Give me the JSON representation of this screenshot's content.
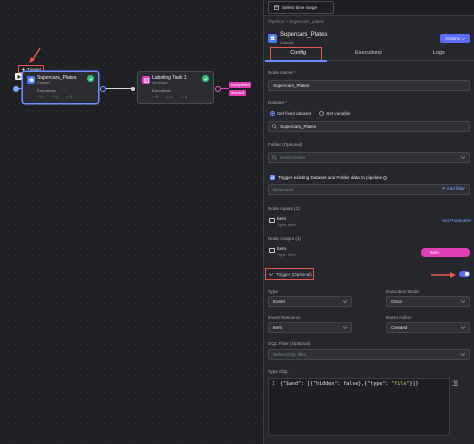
{
  "canvas": {
    "trigger_tag": "Trigger",
    "nodes": [
      {
        "title": "Supercars_Plates",
        "subtitle": "Dataset",
        "executions_label": "Executions",
        "stats": [
          "0",
          "0",
          "0"
        ]
      },
      {
        "title": "Labeling Task 1",
        "subtitle": "Workflow",
        "executions_label": "Executions",
        "stats": [
          "0",
          "0",
          "0"
        ]
      }
    ],
    "edge_labels": [
      "completed",
      "discard"
    ]
  },
  "panel": {
    "time_range_label": "Select time range",
    "breadcrumb": "Pipeline  >  Supercars_plates",
    "header": {
      "title": "Supercars_Plates",
      "subtitle": "Dataset",
      "actions_label": "Actions"
    },
    "tabs": [
      "Config",
      "Executions",
      "Logs"
    ],
    "node_name_label": "Node Name *",
    "node_name_value": "Supercars_Plates",
    "dataset_label": "Dataset *",
    "radio_fixed": "Set fixed dataset",
    "radio_variable": "Set variable",
    "dataset_value": "Supercars_Plates",
    "folder_label": "Folder (Optional)",
    "folder_placeholder": "Select folder",
    "checkbox_label": "Trigger existing Dataset and Folder data to pipeline",
    "filter_placeholder": "Items count",
    "add_filter": "Add filter",
    "node_inputs_label": "Node Inputs (1)",
    "input_item": "Item",
    "input_type": "Type: Item",
    "set_parameter": "Set Parameter",
    "node_output_label": "Node Output (1)",
    "output_item": "Item",
    "output_type": "Type: Item",
    "output_pill": "Item",
    "trigger_optional": "Trigger (Optional)",
    "type_label": "Type",
    "type_value": "Event",
    "exec_mode_label": "Execution Mode",
    "exec_mode_value": "Once",
    "event_resource_label": "Event Resource",
    "event_resource_value": "Item",
    "event_action_label": "Event Action",
    "event_action_value": "Created",
    "dql_filter_label": "DQL Filter (Optional)",
    "dql_filter_placeholder": "Select DQL filter",
    "type_dql_label": "Type DQL",
    "code_line_number": "1",
    "code_pre": "{\"$and\": [{\"hidden\": false},{\"type\": ",
    "code_str": "\"file\"",
    "code_post": "}]}"
  },
  "colors": {
    "accent": "#5b6bff",
    "highlight": "#e05a4e",
    "pink": "#e03eb4",
    "success": "#36c27a"
  }
}
